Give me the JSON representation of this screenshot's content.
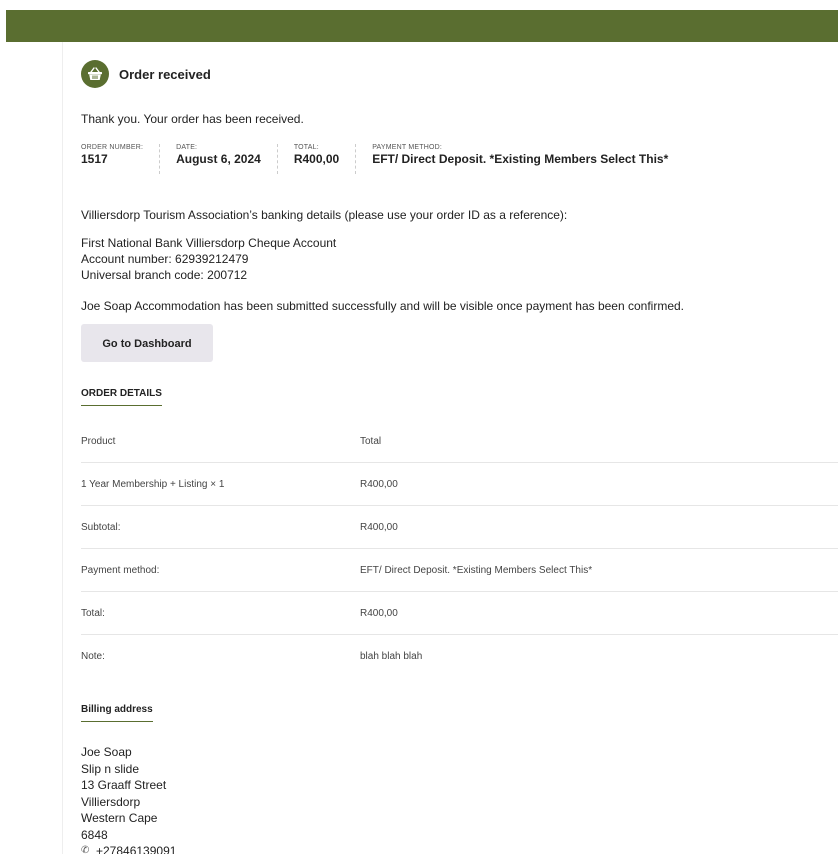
{
  "order": {
    "heading": "Order received",
    "thanks": "Thank you. Your order has been received.",
    "overview": [
      {
        "label": "ORDER NUMBER:",
        "value": "1517"
      },
      {
        "label": "DATE:",
        "value": "August 6, 2024"
      },
      {
        "label": "TOTAL:",
        "value": "R400,00"
      },
      {
        "label": "PAYMENT METHOD:",
        "value": "EFT/ Direct Deposit. *Existing Members Select This*"
      }
    ]
  },
  "bank": {
    "intro": "Villiersdorp Tourism Association’s banking details (please use your order ID as a reference):",
    "account_name": "First National Bank Villiersdorp Cheque Account",
    "account_number": "Account number: 62939212479",
    "branch_code": "Universal branch code: 200712"
  },
  "submitted_message": "Joe Soap Accommodation has been submitted successfully and will be visible once payment has been confirmed.",
  "dashboard_button": "Go to Dashboard",
  "order_details": {
    "title": "ORDER DETAILS",
    "rows": [
      {
        "label": "Product",
        "value": "Total"
      },
      {
        "label": "1 Year Membership + Listing × 1",
        "value": "R400,00"
      },
      {
        "label": "Subtotal:",
        "value": "R400,00"
      },
      {
        "label": "Payment method:",
        "value": "EFT/ Direct Deposit. *Existing Members Select This*"
      },
      {
        "label": "Total:",
        "value": "R400,00"
      },
      {
        "label": "Note:",
        "value": "blah blah blah"
      }
    ]
  },
  "billing": {
    "title": "Billing address",
    "lines": [
      "Joe Soap",
      "Slip n slide",
      "13 Graaff Street",
      "Villiersdorp",
      "Western Cape",
      "6848"
    ],
    "phone": "+27846139091",
    "phone_icon": "phone-icon"
  },
  "colors": {
    "brand": "#5a6e30",
    "button_bg": "#e8e6ec"
  },
  "icons": {
    "order_icon": "basket-icon"
  }
}
